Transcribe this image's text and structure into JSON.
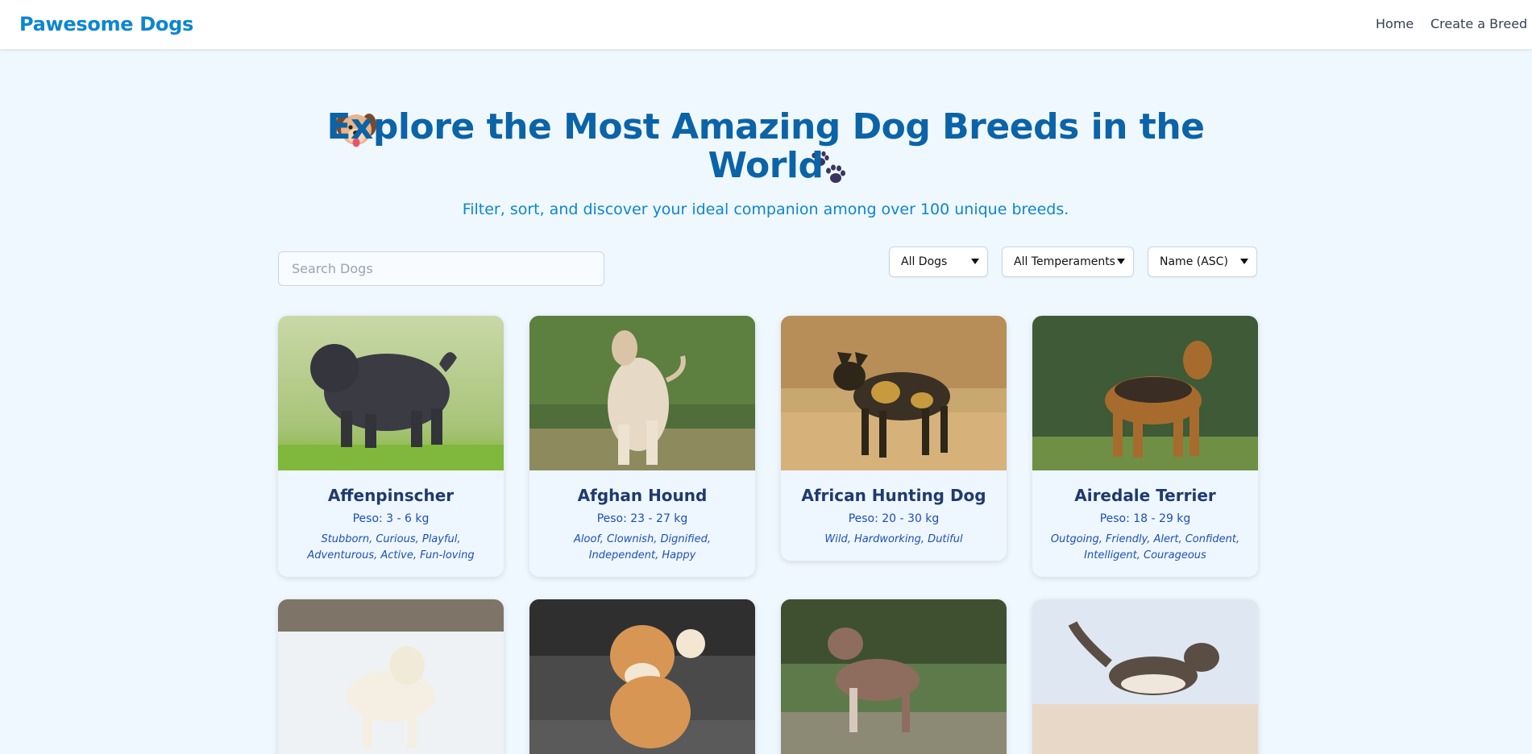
{
  "nav": {
    "brand": "Pawesome Dogs",
    "links": [
      "Home",
      "Create a Breed"
    ]
  },
  "hero": {
    "title": "Explore the Most Amazing Dog Breeds in the World",
    "subtitle": "Filter, sort, and discover your ideal companion among over 100 unique breeds."
  },
  "filters": {
    "search_placeholder": "Search Dogs",
    "origin": "All Dogs",
    "temperament": "All Temperaments",
    "sort": "Name (ASC)"
  },
  "breeds": [
    {
      "name": "Affenpinscher",
      "weight": "Peso: 3 - 6 kg",
      "temperament": "Stubborn, Curious, Playful, Adventurous, Active, Fun-loving"
    },
    {
      "name": "Afghan Hound",
      "weight": "Peso: 23 - 27 kg",
      "temperament": "Aloof, Clownish, Dignified, Independent, Happy"
    },
    {
      "name": "African Hunting Dog",
      "weight": "Peso: 20 - 30 kg",
      "temperament": "Wild, Hardworking, Dutiful"
    },
    {
      "name": "Airedale Terrier",
      "weight": "Peso: 18 - 29 kg",
      "temperament": "Outgoing, Friendly, Alert, Confident, Intelligent, Courageous"
    }
  ],
  "colors": {
    "brand": "#0c86d0",
    "title": "#0b63a8",
    "card_bg": "#eef6ff"
  }
}
